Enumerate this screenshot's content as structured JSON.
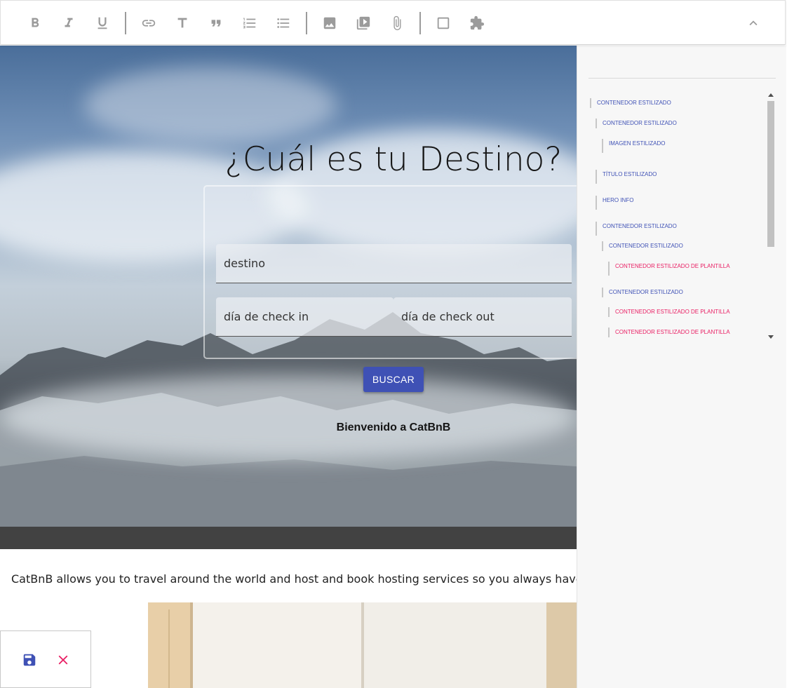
{
  "toolbar": {
    "buttons": [
      "bold-icon",
      "italic-icon",
      "underline-icon",
      "link-icon",
      "title-icon",
      "quote-icon",
      "numbered-list-icon",
      "bulleted-list-icon",
      "image-icon",
      "video-icon",
      "attachment-icon",
      "box-icon",
      "extension-icon",
      "collapse-icon"
    ]
  },
  "hero": {
    "title": "¿Cuál es tu Destino?",
    "destination_placeholder": "destino",
    "checkin_placeholder": "día de check in",
    "checkout_placeholder": "día de check out",
    "search_button": "BUSCAR",
    "welcome": "Bienvenido a CatBnB"
  },
  "description": "CatBnB allows you to travel around the world and host and book hosting services so you always have a place",
  "tree": {
    "items": [
      {
        "label": "CONTENEDOR ESTILIZADO",
        "color": "blue"
      },
      {
        "label": "CONTENEDOR ESTILIZADO",
        "color": "blue"
      },
      {
        "label": "IMAGEN ESTILIZADO",
        "color": "blue"
      },
      {
        "label": "TÍTULO ESTILIZADO",
        "color": "blue"
      },
      {
        "label": "HERO INFO",
        "color": "blue"
      },
      {
        "label": "CONTENEDOR ESTILIZADO",
        "color": "blue"
      },
      {
        "label": "CONTENEDOR ESTILIZADO",
        "color": "blue"
      },
      {
        "label": "CONTENEDOR ESTILIZADO DE PLANTILLA",
        "color": "pink"
      },
      {
        "label": "CONTENEDOR ESTILIZADO",
        "color": "blue"
      },
      {
        "label": "CONTENEDOR ESTILIZADO DE PLANTILLA",
        "color": "pink"
      },
      {
        "label": "CONTENEDOR ESTILIZADO DE PLANTILLA",
        "color": "pink"
      }
    ]
  },
  "colors": {
    "primary": "#3f51b5",
    "accent": "#e91e63",
    "toolbar_icon": "#9b9b9b",
    "dark_band": "#424242"
  },
  "actions": {
    "save_icon": "save-icon",
    "close_icon": "close-icon"
  }
}
